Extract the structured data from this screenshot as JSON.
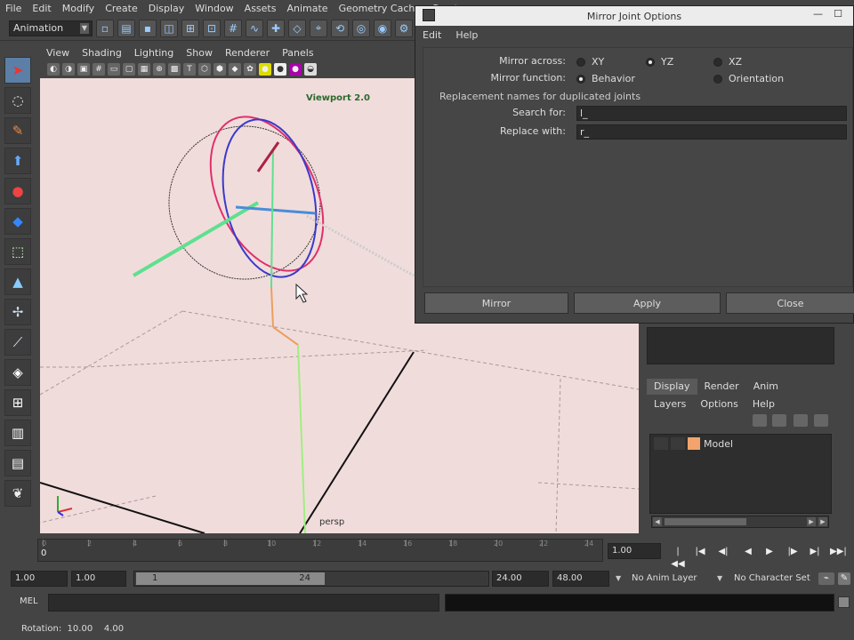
{
  "main_menu": [
    "File",
    "Edit",
    "Modify",
    "Create",
    "Display",
    "Window",
    "Assets",
    "Animate",
    "Geometry Cache",
    "Creat"
  ],
  "status_line": {
    "menu_set": "Animation"
  },
  "panel": {
    "menu": [
      "View",
      "Shading",
      "Lighting",
      "Show",
      "Renderer",
      "Panels"
    ],
    "renderer_label": "Viewport 2.0",
    "camera_label": "persp"
  },
  "dialog": {
    "title": "Mirror Joint Options",
    "menu": [
      "Edit",
      "Help"
    ],
    "mirror_across": {
      "label": "Mirror across:",
      "options": [
        "XY",
        "YZ",
        "XZ"
      ],
      "selected": "YZ"
    },
    "mirror_function": {
      "label": "Mirror function:",
      "options": [
        "Behavior",
        "Orientation"
      ],
      "selected": "Behavior"
    },
    "replacement_section": "Replacement names for duplicated joints",
    "search_for": {
      "label": "Search for:",
      "value": "l_"
    },
    "replace_with": {
      "label": "Replace with:",
      "value": "r_"
    },
    "buttons": {
      "mirror": "Mirror",
      "apply": "Apply",
      "close": "Close"
    }
  },
  "layer_editor": {
    "tabs": [
      "Display",
      "Render",
      "Anim"
    ],
    "active_tab": "Display",
    "menu": [
      "Layers",
      "Options",
      "Help"
    ],
    "layers": [
      {
        "name": "Model",
        "color": "#f2a46c"
      }
    ]
  },
  "time_slider": {
    "tick_labels": [
      "0",
      "2",
      "4",
      "6",
      "8",
      "10",
      "12",
      "14",
      "16",
      "18",
      "20",
      "22",
      "24"
    ],
    "current_frame": "0",
    "current_time": "1.00"
  },
  "range_slider": {
    "start_time": "1.00",
    "playback_start": "1.00",
    "handle_start": "1",
    "handle_end": "24",
    "playback_end": "24.00",
    "end_time": "48.00",
    "anim_layer": "No Anim Layer",
    "character_set": "No Character Set"
  },
  "command_line": {
    "label": "MEL"
  },
  "help_line": {
    "text": "Rotation:  10.00    4.00"
  }
}
